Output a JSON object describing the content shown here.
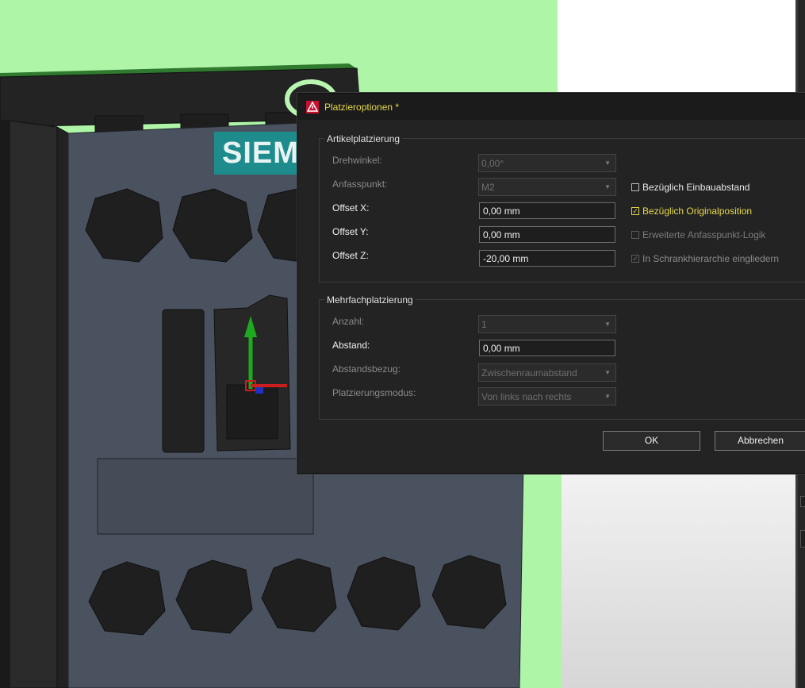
{
  "dialog": {
    "title": "Platzieroptionen *",
    "ok_label": "OK",
    "cancel_label": "Abbrechen"
  },
  "brand_text": "SIEM",
  "artikel": {
    "group_title": "Artikelplatzierung",
    "drehwinkel": {
      "label": "Drehwinkel:",
      "value": "0,00°"
    },
    "anfasspunkt": {
      "label": "Anfasspunkt:",
      "value": "M2"
    },
    "offset_x": {
      "label": "Offset X:",
      "value": "0,00 mm"
    },
    "offset_y": {
      "label": "Offset Y:",
      "value": "0,00 mm"
    },
    "offset_z": {
      "label": "Offset Z:",
      "value": "-20,00 mm"
    },
    "cb_einbau": {
      "label": "Bezüglich Einbauabstand",
      "checked": false
    },
    "cb_original": {
      "label": "Bezüglich Originalposition",
      "checked": true
    },
    "cb_erweitert": {
      "label": "Erweiterte Anfasspunkt-Logik",
      "checked": false
    },
    "cb_schrank": {
      "label": "In Schrankhierarchie eingliedern",
      "checked": true
    }
  },
  "mehrfach": {
    "group_title": "Mehrfachplatzierung",
    "anzahl": {
      "label": "Anzahl:",
      "value": "1"
    },
    "abstand": {
      "label": "Abstand:",
      "value": "0,00 mm"
    },
    "abstandsbezug": {
      "label": "Abstandsbezug:",
      "value": "Zwischenraumabstand"
    },
    "modus": {
      "label": "Platzierungsmodus:",
      "value": "Von links nach rechts"
    }
  },
  "colors": {
    "viewport_bg": "#aef5a8",
    "device_body": "#4a5260",
    "brand_plate": "#1e8c8c",
    "title_accent": "#e6d84c",
    "checkbox_accent": "#d8d04a"
  }
}
